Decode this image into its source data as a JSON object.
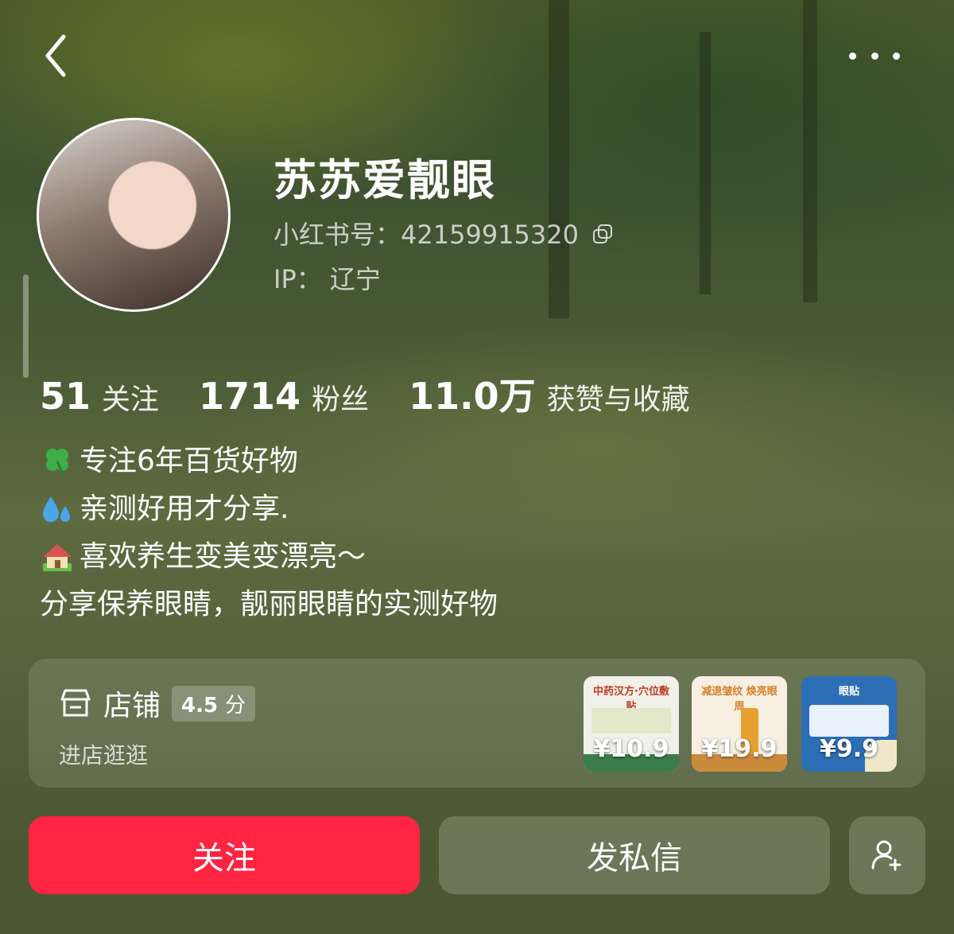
{
  "nav": {
    "back_icon": "chevron-left-icon",
    "more_icon": "more-horizontal-icon"
  },
  "profile": {
    "name": "苏苏爱靓眼",
    "id_label": "小红书号：",
    "id_value": "42159915320",
    "ip_label": "IP：",
    "ip_value": "辽宁"
  },
  "stats": [
    {
      "num": "51",
      "label": "关注"
    },
    {
      "num": "1714",
      "label": "粉丝"
    },
    {
      "num": "11.0万",
      "label": "获赞与收藏"
    }
  ],
  "bio": [
    {
      "icon": "clover-icon",
      "text": "专注6年百货好物"
    },
    {
      "icon": "droplets-icon",
      "text": "亲测好用才分享."
    },
    {
      "icon": "house-icon",
      "text": "喜欢养生变美变漂亮～"
    },
    {
      "icon": "",
      "text": "分享保养眼睛，靓丽眼睛的实测好物"
    }
  ],
  "shop": {
    "title": "店铺",
    "rating": "4.5",
    "rating_unit": "分",
    "subtitle": "进店逛逛",
    "products": [
      {
        "price": "¥10.9",
        "caption": "中药汉方·穴位敷贴",
        "bg": "#f1f1ea"
      },
      {
        "price": "¥19.9",
        "caption": "减退皱纹 焕亮眼周",
        "bg": "#f6efe2"
      },
      {
        "price": "¥9.9",
        "caption": "眼贴",
        "bg": "#2d6fb6"
      }
    ]
  },
  "actions": {
    "follow_label": "关注",
    "message_label": "发私信",
    "add_friend_icon": "add-user-icon"
  },
  "colors": {
    "follow": "#ff2442"
  }
}
